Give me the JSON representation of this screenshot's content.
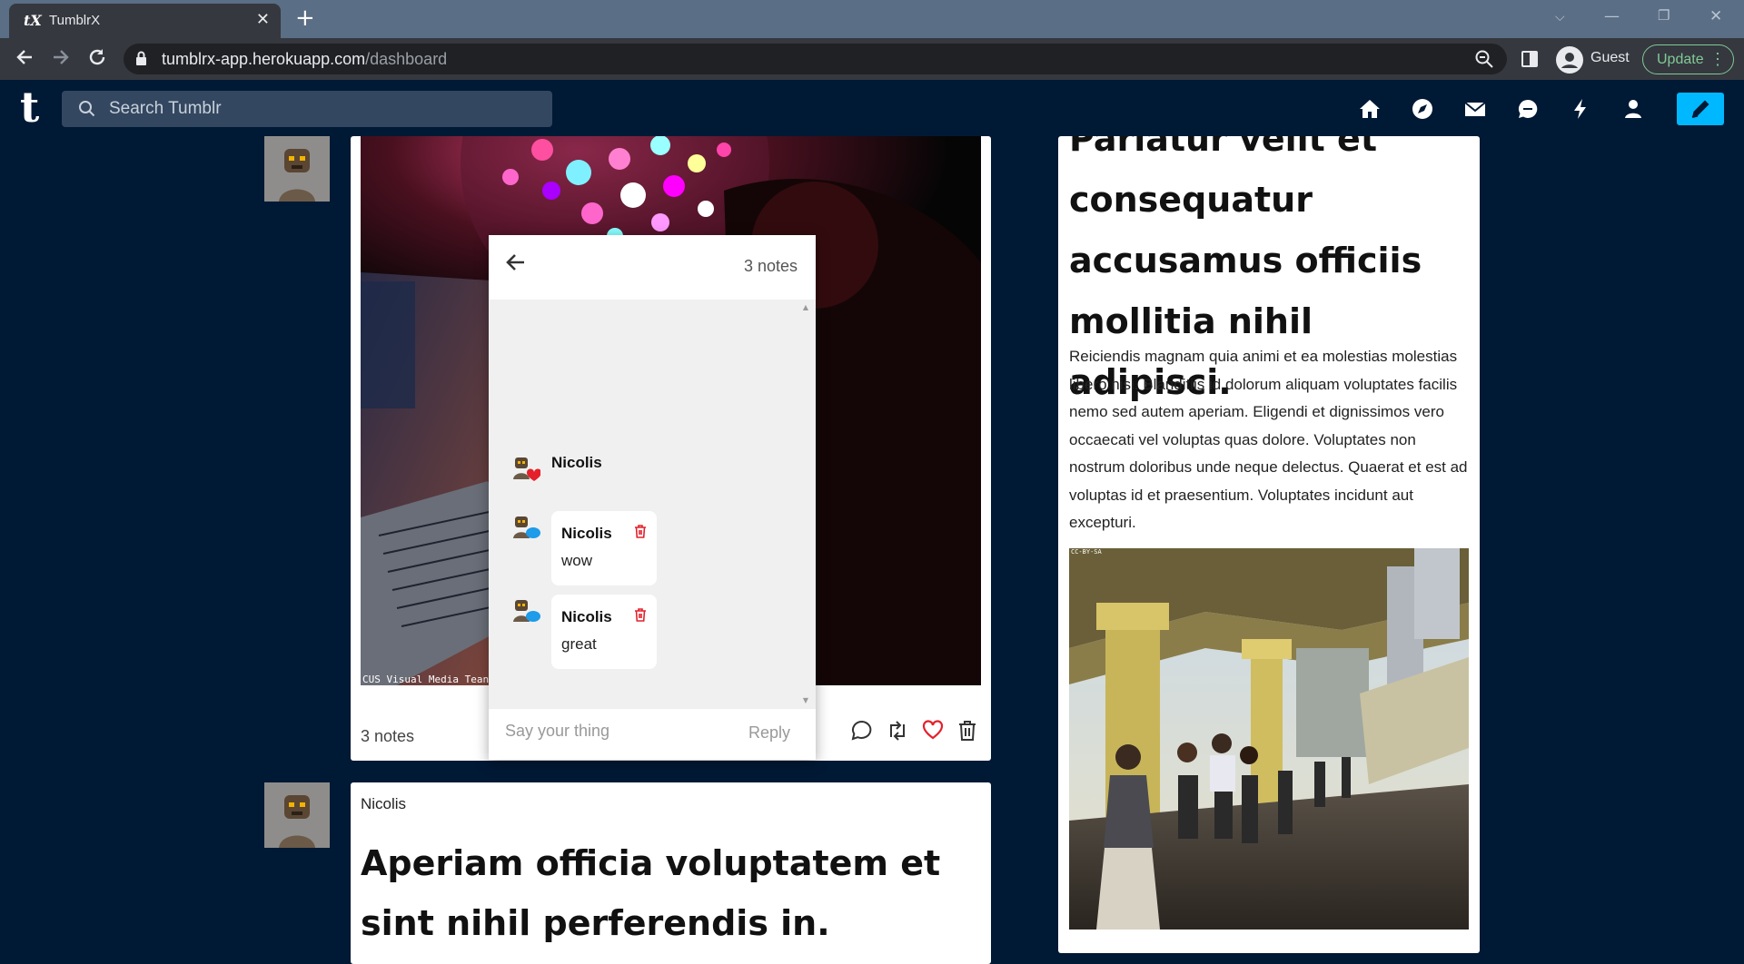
{
  "browser": {
    "tab_title": "TumblrX",
    "favicon": "tX",
    "url_host": "tumblrx-app.herokuapp.com",
    "url_path": "/dashboard",
    "profile_name": "Guest",
    "update_label": "Update"
  },
  "header": {
    "search_placeholder": "Search Tumblr",
    "accent_color": "#00b8ff",
    "background_color": "#001935"
  },
  "post1": {
    "photo_caption": "CUS Visual Media Tean",
    "notes_label": "3 notes"
  },
  "notes_popup": {
    "count_label": "3 notes",
    "like": {
      "name": "Nicolis"
    },
    "comments": [
      {
        "name": "Nicolis",
        "text": "wow"
      },
      {
        "name": "Nicolis",
        "text": "great"
      }
    ],
    "reply_placeholder": "Say your thing",
    "reply_label": "Reply"
  },
  "post2": {
    "author": "Nicolis",
    "title": "Aperiam officia voluptatem et sint nihil perferendis in."
  },
  "post3": {
    "title": "Pariatur velit et consequatur accusamus officiis mollitia nihil adipisci.",
    "body": "Reiciendis magnam quia animi et ea molestias molestias libero nisi. Blanditiis id dolorum aliquam voluptates facilis nemo sed autem aperiam. Eligendi et dignissimos vero occaecati vel voluptas quas dolore. Voluptates non nostrum doloribus unde neque delectus. Quaerat et est ad voluptas id et praesentium. Voluptates incidunt aut excepturi.",
    "photo_caption": "CC-BY-SA"
  }
}
